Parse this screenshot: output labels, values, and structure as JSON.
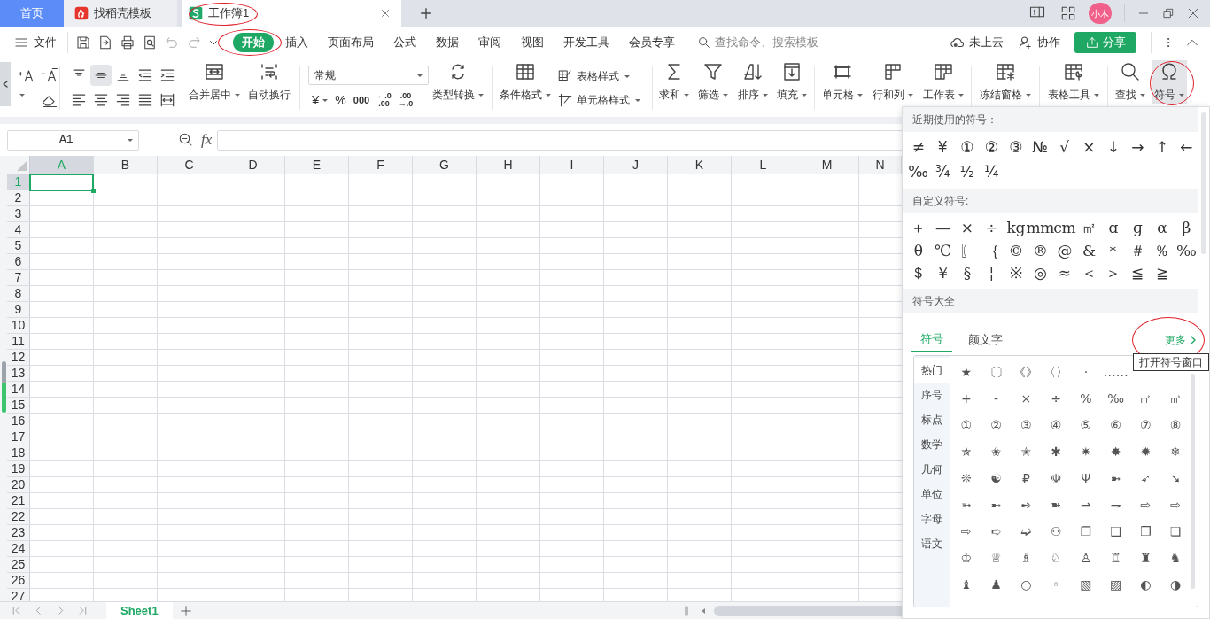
{
  "tabs": [
    {
      "label": "首页",
      "selected": false
    },
    {
      "label": "找稻壳模板",
      "selected": false
    },
    {
      "label": "工作簿1",
      "selected": true
    }
  ],
  "avatar": "小木",
  "menu": {
    "file": "文件",
    "tabs": [
      {
        "label": "开始",
        "selected": true
      },
      {
        "label": "插入",
        "selected": false
      },
      {
        "label": "页面布局",
        "selected": false
      },
      {
        "label": "公式",
        "selected": false
      },
      {
        "label": "数据",
        "selected": false
      },
      {
        "label": "审阅",
        "selected": false
      },
      {
        "label": "视图",
        "selected": false
      },
      {
        "label": "开发工具",
        "selected": false
      },
      {
        "label": "会员专享",
        "selected": false
      }
    ],
    "search_placeholder": "查找命令、搜索模板",
    "cloud": "未上云",
    "collab": "协作",
    "share": "分享"
  },
  "ribbon": {
    "number_format": "常规",
    "currency": "¥",
    "percent": "%",
    "thousands": "000",
    "decimal_more": {
      "top": "←.0",
      "bottom": ".00"
    },
    "decimal_less": {
      "top": ".00",
      "bottom": "→.0"
    },
    "buttons": [
      {
        "label": "合并居中",
        "dropdown": true,
        "selected": false
      },
      {
        "label": "自动换行",
        "dropdown": false,
        "selected": false
      },
      {
        "label": "类型转换",
        "dropdown": true,
        "selected": false
      },
      {
        "label": "条件格式",
        "dropdown": true,
        "selected": false
      },
      {
        "label": "表格样式",
        "dropdown": true,
        "selected": false
      },
      {
        "label": "单元格样式",
        "dropdown": true,
        "selected": false
      },
      {
        "label": "求和",
        "dropdown": true,
        "selected": false
      },
      {
        "label": "筛选",
        "dropdown": true,
        "selected": false
      },
      {
        "label": "排序",
        "dropdown": true,
        "selected": false
      },
      {
        "label": "填充",
        "dropdown": true,
        "selected": false
      },
      {
        "label": "单元格",
        "dropdown": true,
        "selected": false
      },
      {
        "label": "行和列",
        "dropdown": true,
        "selected": false
      },
      {
        "label": "工作表",
        "dropdown": true,
        "selected": false
      },
      {
        "label": "冻结窗格",
        "dropdown": true,
        "selected": false
      },
      {
        "label": "表格工具",
        "dropdown": true,
        "selected": false
      },
      {
        "label": "查找",
        "dropdown": true,
        "selected": false
      },
      {
        "label": "符号",
        "dropdown": true,
        "selected": true
      }
    ]
  },
  "formula_bar": {
    "cell_ref": "A1",
    "fx": "fx"
  },
  "grid": {
    "columns": [
      {
        "label": "A",
        "selected": true
      },
      {
        "label": "B",
        "selected": false
      },
      {
        "label": "C",
        "selected": false
      },
      {
        "label": "D",
        "selected": false
      },
      {
        "label": "E",
        "selected": false
      },
      {
        "label": "F",
        "selected": false
      },
      {
        "label": "G",
        "selected": false
      },
      {
        "label": "H",
        "selected": false
      },
      {
        "label": "I",
        "selected": false
      },
      {
        "label": "J",
        "selected": false
      },
      {
        "label": "K",
        "selected": false
      },
      {
        "label": "L",
        "selected": false
      },
      {
        "label": "M",
        "selected": false
      },
      {
        "label": "N",
        "selected": false
      }
    ],
    "rows": [
      {
        "label": "1",
        "selected": true
      },
      {
        "label": "2",
        "selected": false
      },
      {
        "label": "3",
        "selected": false
      },
      {
        "label": "4",
        "selected": false
      },
      {
        "label": "5",
        "selected": false
      },
      {
        "label": "6",
        "selected": false
      },
      {
        "label": "7",
        "selected": false
      },
      {
        "label": "8",
        "selected": false
      },
      {
        "label": "9",
        "selected": false
      },
      {
        "label": "10",
        "selected": false
      },
      {
        "label": "11",
        "selected": false
      },
      {
        "label": "12",
        "selected": false
      },
      {
        "label": "13",
        "selected": false
      },
      {
        "label": "14",
        "selected": false
      },
      {
        "label": "15",
        "selected": false
      },
      {
        "label": "16",
        "selected": false
      },
      {
        "label": "17",
        "selected": false
      },
      {
        "label": "18",
        "selected": false
      },
      {
        "label": "19",
        "selected": false
      },
      {
        "label": "20",
        "selected": false
      },
      {
        "label": "21",
        "selected": false
      },
      {
        "label": "22",
        "selected": false
      },
      {
        "label": "23",
        "selected": false
      },
      {
        "label": "24",
        "selected": false
      },
      {
        "label": "25",
        "selected": false
      },
      {
        "label": "26",
        "selected": false
      },
      {
        "label": "27",
        "selected": false
      }
    ]
  },
  "sheets": [
    {
      "label": "Sheet1",
      "selected": true
    }
  ],
  "symbol_panel": {
    "recent_title": "近期使用的符号：",
    "recent": [
      "≠",
      "¥",
      "①",
      "②",
      "③",
      "№",
      "√",
      "×",
      "↓",
      "→",
      "↑",
      "←",
      "‰",
      "¾",
      "½",
      "¼"
    ],
    "custom_title": "自定义符号:",
    "custom": [
      "＋",
      "—",
      "×",
      "÷",
      "kg",
      "mm",
      "cm",
      "㎡",
      "ɑ",
      "ɡ",
      "α",
      "β",
      "θ",
      "℃",
      "〖",
      "｛",
      "©",
      "®",
      "@",
      "&",
      "＊",
      "＃",
      "％",
      "‰",
      "＄",
      "￥",
      "§",
      "¦",
      "※",
      "◎",
      "≈",
      "＜",
      "＞",
      "≦",
      "≧"
    ],
    "library_title": "符号大全",
    "tabs": [
      {
        "label": "符号",
        "selected": true
      },
      {
        "label": "颜文字",
        "selected": false
      }
    ],
    "more": "更多",
    "tooltip": "打开符号窗口",
    "categories": [
      {
        "label": "热门",
        "selected": true
      },
      {
        "label": "序号",
        "selected": false
      },
      {
        "label": "标点",
        "selected": false
      },
      {
        "label": "数学",
        "selected": false
      },
      {
        "label": "几何",
        "selected": false
      },
      {
        "label": "单位",
        "selected": false
      },
      {
        "label": "字母",
        "selected": false
      },
      {
        "label": "语文",
        "selected": false
      }
    ],
    "symbol_rows": [
      [
        "★",
        "〔〕",
        "《》",
        "〈〉",
        "·",
        "……"
      ],
      [
        "+",
        "-",
        "×",
        "÷",
        "%",
        "‰",
        "㎡",
        "㎥"
      ],
      [
        "①",
        "②",
        "③",
        "④",
        "⑤",
        "⑥",
        "⑦",
        "⑧"
      ],
      [
        "✯",
        "✬",
        "✭",
        "✱",
        "✷",
        "✸",
        "✹",
        "❄"
      ],
      [
        "❊",
        "☯",
        "₽",
        "☫",
        "Ψ",
        "➼",
        "➶",
        "➘"
      ],
      [
        "➳",
        "➸",
        "➺",
        "➽",
        "⇀",
        "⇁",
        "⇨",
        "⇨"
      ],
      [
        "⇨",
        "➪",
        "➫",
        "⚇",
        "❐",
        "❑",
        "❒",
        "❏"
      ],
      [
        "♔",
        "♕",
        "♗",
        "♘",
        "♙",
        "♖",
        "♜",
        "♞"
      ],
      [
        "♝",
        "♟",
        "○",
        "◦",
        "▧",
        "▨",
        "◐",
        "◑"
      ]
    ]
  }
}
